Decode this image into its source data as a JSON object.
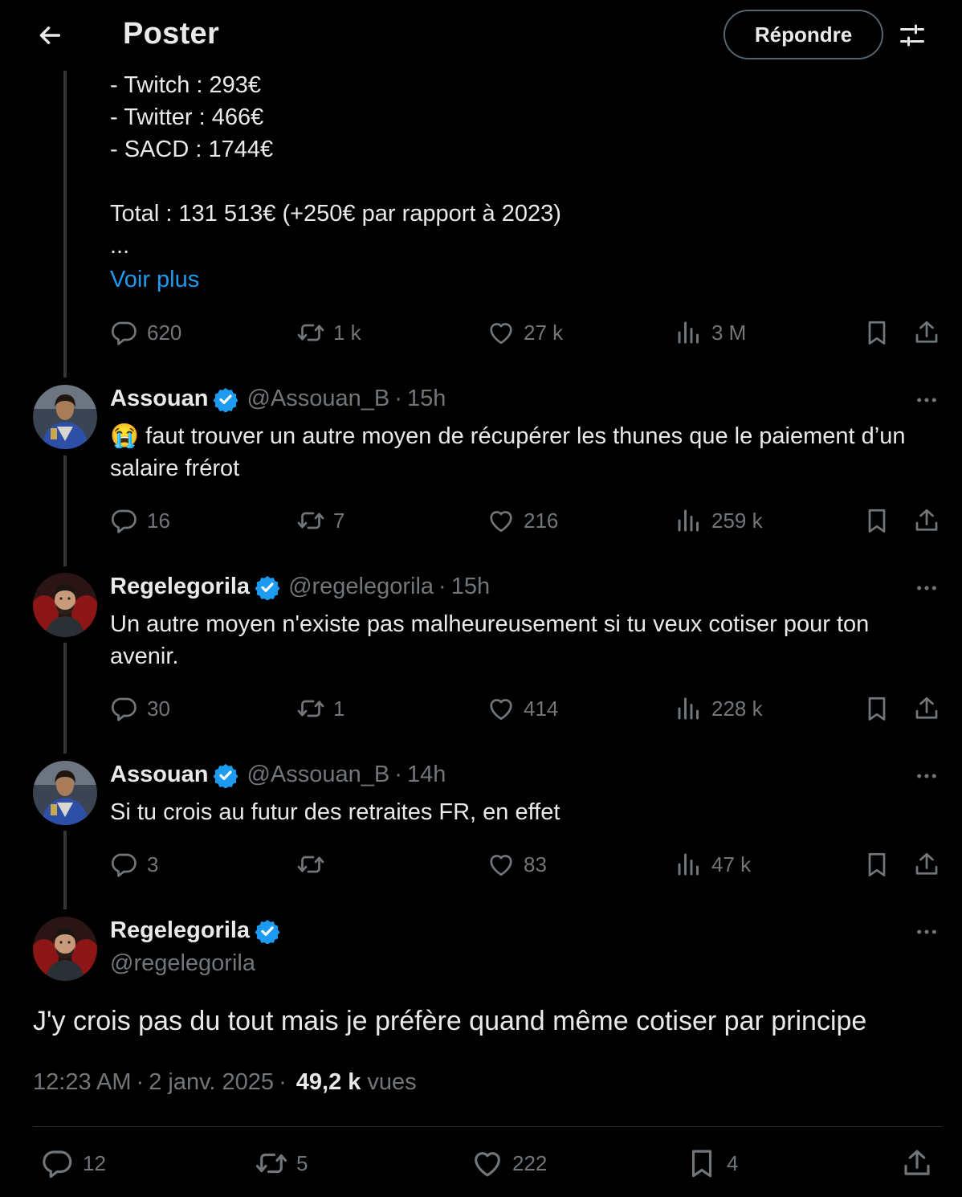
{
  "header": {
    "title": "Poster",
    "reply_label": "Répondre"
  },
  "colors": {
    "accent": "#1d9bf0",
    "muted": "#71767b",
    "text": "#e7e9ea",
    "background": "#000000"
  },
  "original_post": {
    "lines": [
      "- Twitch : 293€",
      "- Twitter : 466€",
      "- SACD : 1744€",
      "Total : 131 513€ (+250€ par rapport à 2023)",
      "..."
    ],
    "show_more": "Voir plus",
    "stats": {
      "replies": "620",
      "reposts": "1 k",
      "likes": "27 k",
      "views": "3 M"
    }
  },
  "replies": [
    {
      "name": "Assouan",
      "handle": "@Assouan_B",
      "time": "15h",
      "text": "😭 faut trouver un autre moyen de récupérer les thunes que le paiement d’un salaire frérot",
      "stats": {
        "replies": "16",
        "reposts": "7",
        "likes": "216",
        "views": "259 k"
      }
    },
    {
      "name": "Regelegorila",
      "handle": "@regelegorila",
      "time": "15h",
      "text": "Un autre moyen n'existe pas malheureusement si tu veux cotiser pour ton avenir.",
      "stats": {
        "replies": "30",
        "reposts": "1",
        "likes": "414",
        "views": "228 k"
      }
    },
    {
      "name": "Assouan",
      "handle": "@Assouan_B",
      "time": "14h",
      "text": "Si tu crois au futur des retraites FR, en effet",
      "stats": {
        "replies": "3",
        "reposts": "",
        "likes": "83",
        "views": "47 k"
      }
    }
  ],
  "main_post": {
    "name": "Regelegorila",
    "handle": "@regelegorila",
    "text": "J'y crois pas du tout mais je préfère quand même cotiser par principe",
    "time": "12:23 AM",
    "date": "2 janv. 2025",
    "views_count": "49,2 k",
    "views_label": "vues",
    "stats": {
      "replies": "12",
      "reposts": "5",
      "likes": "222",
      "bookmarks": "4"
    }
  },
  "icons": [
    "back-arrow-icon",
    "settings-sliders-icon",
    "reply-icon",
    "repost-icon",
    "like-icon",
    "views-icon",
    "bookmark-icon",
    "share-icon",
    "more-icon",
    "verified-badge-icon"
  ]
}
